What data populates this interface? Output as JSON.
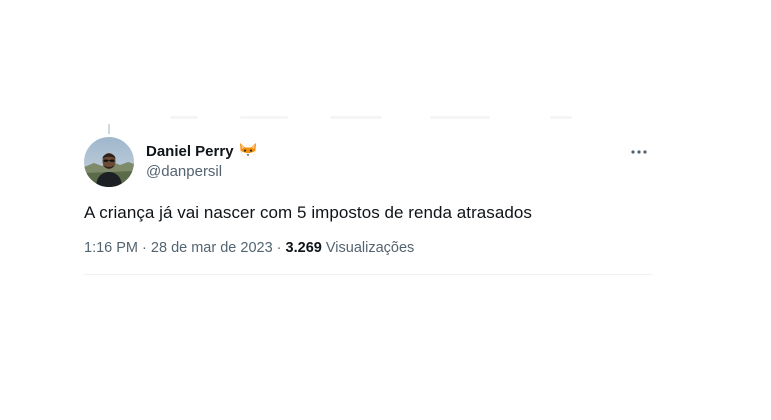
{
  "tweet": {
    "author": {
      "display_name": "Daniel Perry",
      "emoji_icon": "fox-face-icon",
      "handle": "@danpersil"
    },
    "text": "A criança já vai nascer com 5 impostos de renda atrasados",
    "meta": {
      "time": "1:16 PM",
      "separator": "·",
      "date": "28 de mar de 2023",
      "views_count": "3.269",
      "views_label": "Visualizações"
    },
    "more_icon": "ellipsis-icon"
  },
  "colors": {
    "primary_text": "#0f1419",
    "secondary_text": "#536471",
    "divider": "#eff3f4"
  }
}
